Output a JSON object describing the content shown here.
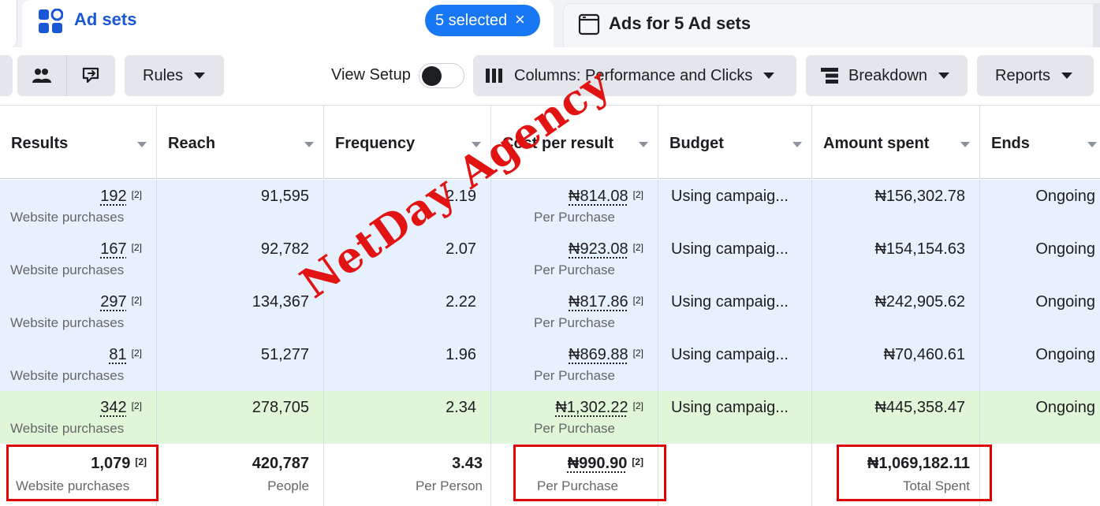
{
  "tabs": {
    "ad_sets": {
      "label": "Ad sets",
      "selection_label": "5 selected",
      "clear_icon": "×"
    },
    "ads": {
      "label": "Ads for 5 Ad sets"
    }
  },
  "toolbar": {
    "rules_label": "Rules",
    "view_setup_label": "View Setup",
    "view_setup_on": false,
    "columns_label": "Columns: Performance and Clicks",
    "breakdown_label": "Breakdown",
    "reports_label": "Reports"
  },
  "table": {
    "headers": [
      "Results",
      "Reach",
      "Frequency",
      "Cost per result",
      "Budget",
      "Amount spent",
      "Ends"
    ],
    "rows": [
      {
        "results": "192",
        "results_ref": "[2]",
        "results_type": "Website purchases",
        "reach": "91,595",
        "frequency": "2.19",
        "cpr": "₦814.08",
        "cpr_ref": "[2]",
        "cpr_type": "Per Purchase",
        "budget": "Using campaig...",
        "spent": "₦156,302.78",
        "ends": "Ongoing"
      },
      {
        "results": "167",
        "results_ref": "[2]",
        "results_type": "Website purchases",
        "reach": "92,782",
        "frequency": "2.07",
        "cpr": "₦923.08",
        "cpr_ref": "[2]",
        "cpr_type": "Per Purchase",
        "budget": "Using campaig...",
        "spent": "₦154,154.63",
        "ends": "Ongoing"
      },
      {
        "results": "297",
        "results_ref": "[2]",
        "results_type": "Website purchases",
        "reach": "134,367",
        "frequency": "2.22",
        "cpr": "₦817.86",
        "cpr_ref": "[2]",
        "cpr_type": "Per Purchase",
        "budget": "Using campaig...",
        "spent": "₦242,905.62",
        "ends": "Ongoing"
      },
      {
        "results": "81",
        "results_ref": "[2]",
        "results_type": "Website purchases",
        "reach": "51,277",
        "frequency": "1.96",
        "cpr": "₦869.88",
        "cpr_ref": "[2]",
        "cpr_type": "Per Purchase",
        "budget": "Using campaig...",
        "spent": "₦70,460.61",
        "ends": "Ongoing"
      },
      {
        "results": "342",
        "results_ref": "[2]",
        "results_type": "Website purchases",
        "reach": "278,705",
        "frequency": "2.34",
        "cpr": "₦1,302.22",
        "cpr_ref": "[2]",
        "cpr_type": "Per Purchase",
        "budget": "Using campaig...",
        "spent": "₦445,358.47",
        "ends": "Ongoing"
      }
    ],
    "totals": {
      "results": "1,079",
      "results_ref": "[2]",
      "results_type": "Website purchases",
      "reach": "420,787",
      "reach_type": "People",
      "frequency": "3.43",
      "frequency_type": "Per Person",
      "cpr": "₦990.90",
      "cpr_ref": "[2]",
      "cpr_type": "Per Purchase",
      "spent": "₦1,069,182.11",
      "spent_type": "Total Spent"
    }
  },
  "watermark": "NetDay Agency",
  "colors": {
    "accent": "#1877f2",
    "highlight": "#e00000",
    "row_blue": "#e7f0fd",
    "row_green": "#e1f5d8"
  }
}
